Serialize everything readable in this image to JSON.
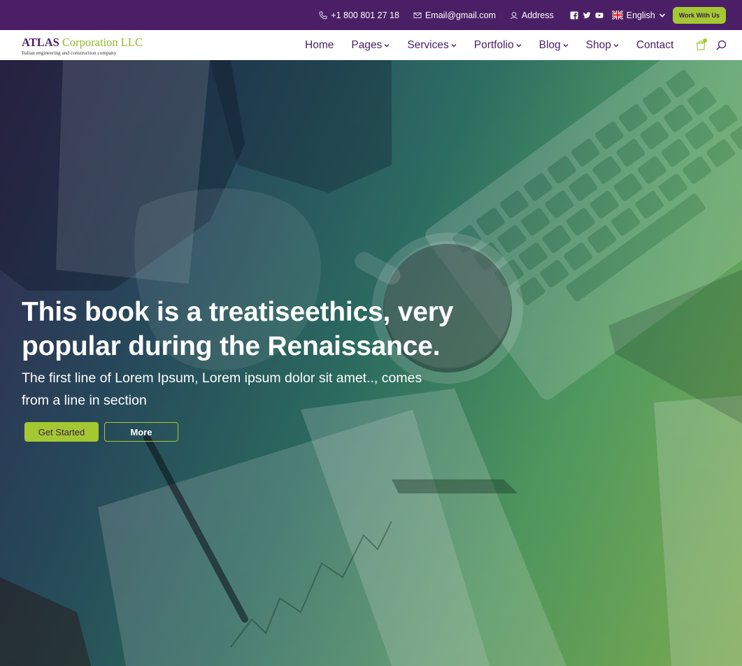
{
  "topbar": {
    "phone": "+1 800 801 27 18",
    "email": "Email@gmail.com",
    "address": "Address",
    "language": "English",
    "cta": "Work With Us",
    "icons": [
      "phone-icon",
      "mail-icon",
      "location-icon",
      "facebook-icon",
      "twitter-icon",
      "youtube-icon",
      "uk-flag-icon",
      "chevron-down-icon"
    ]
  },
  "brand": {
    "name": "ATLAS",
    "name_accent": "Corporation LLC",
    "tagline": "Italian engineering and construction company"
  },
  "nav": {
    "items": [
      {
        "label": "Home",
        "dropdown": false
      },
      {
        "label": "Pages",
        "dropdown": true
      },
      {
        "label": "Services",
        "dropdown": true
      },
      {
        "label": "Portfolio",
        "dropdown": true
      },
      {
        "label": "Blog",
        "dropdown": true
      },
      {
        "label": "Shop",
        "dropdown": true
      },
      {
        "label": "Contact",
        "dropdown": false
      }
    ],
    "icons": [
      "cart-icon",
      "search-icon"
    ]
  },
  "hero": {
    "title_line1": "This book is a treatiseethics, very",
    "title_line2": "popular during the Renaissance.",
    "subtitle_line1": "The first line of Lorem Ipsum, Lorem ipsum dolor sit amet.., comes",
    "subtitle_line2": "from a line in section",
    "primary_button": "Get Started",
    "secondary_button": "More"
  },
  "colors": {
    "topbar": "#4a1f66",
    "accent": "#a4c832",
    "nav_text": "#4a1f66",
    "hero_start": "#3a2a55",
    "hero_end": "#8cc35b"
  }
}
